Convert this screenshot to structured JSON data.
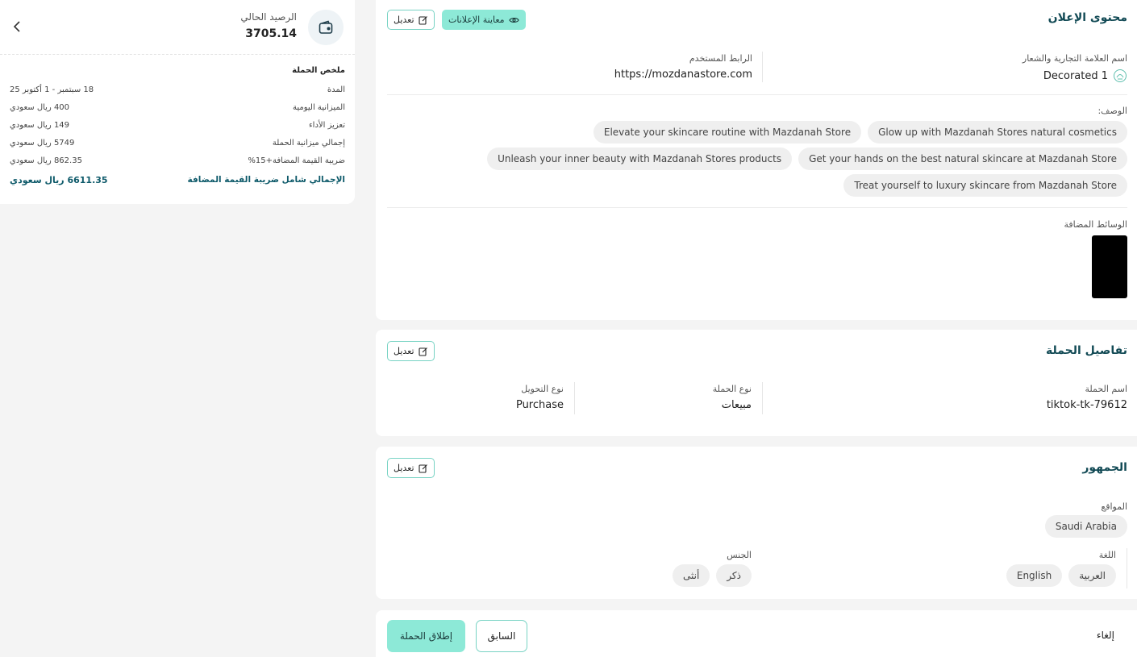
{
  "balance": {
    "label": "الرصيد الحالي",
    "value": "3705.14"
  },
  "summary": {
    "title": "ملخص الحملة",
    "rows": [
      {
        "label": "المدة",
        "value": "18 سبتمبر - 1 أكتوبر 25"
      },
      {
        "label": "الميزانية اليومية",
        "value": "400 ريال سعودي"
      },
      {
        "label": "تعزيز الأداء",
        "value": "149 ريال سعودي"
      },
      {
        "label": "إجمالي ميزانية الحملة",
        "value": "5749 ريال سعودي"
      },
      {
        "label": "ضريبة القيمة المضافة+15%",
        "value": "862.35 ريال سعودي"
      }
    ],
    "total_label": "الإجمالي شامل ضريبة القيمة المضافة",
    "total_value": "6611.35 ريال سعودي"
  },
  "ad_content": {
    "title": "محتوى الإعلان",
    "preview_label": "معاينة الإعلانات",
    "edit_label": "تعديل",
    "brand_label": "اسم العلامة التجارية والشعار",
    "brand_value": "Decorated 1",
    "url_label": "الرابط المستخدم",
    "url_value": "https://mozdanastore.com",
    "description_label": "الوصف:",
    "descriptions": [
      "Glow up with Mazdanah Stores natural cosmetics",
      "Elevate your skincare routine with Mazdanah Store",
      "Get your hands on the best natural skincare at Mazdanah Store",
      "Unleash your inner beauty with Mazdanah Stores products",
      "Treat yourself to luxury skincare from Mazdanah Store"
    ],
    "media_label": "الوسائط المضافة"
  },
  "campaign_details": {
    "title": "تفاصيل الحملة",
    "edit_label": "تعديل",
    "name_label": "اسم الحملة",
    "name_value": "tiktok-tk-79612",
    "type_label": "نوع الحملة",
    "type_value": "مبيعات",
    "conversion_label": "نوع التحويل",
    "conversion_value": "Purchase"
  },
  "audience": {
    "title": "الجمهور",
    "edit_label": "تعديل",
    "locations_label": "المواقع",
    "locations": [
      "Saudi Arabia"
    ],
    "language_label": "اللغة",
    "languages": [
      "العربية",
      "English"
    ],
    "gender_label": "الجنس",
    "genders": [
      "ذكر",
      "أنثى"
    ]
  },
  "footer": {
    "cancel_label": "إلغاء",
    "previous_label": "السابق",
    "launch_label": "إطلاق الحملة"
  },
  "colors": {
    "accent": "#8de9d7",
    "accent_border": "#78d3c4",
    "title": "#124a55"
  }
}
